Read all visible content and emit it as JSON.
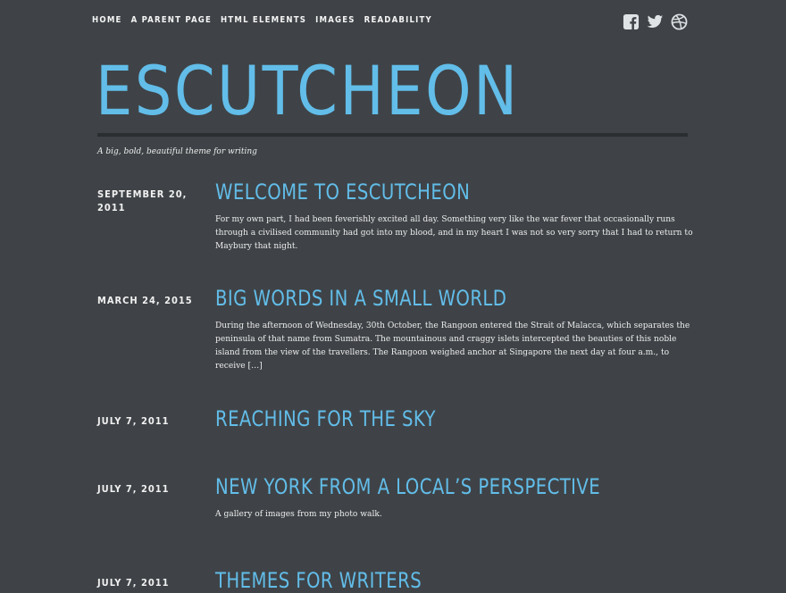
{
  "nav": {
    "items": [
      "HOME",
      "A PARENT PAGE",
      "HTML ELEMENTS",
      "IMAGES",
      "READABILITY"
    ]
  },
  "social": {
    "icons": [
      "facebook-icon",
      "twitter-icon",
      "dribbble-icon"
    ]
  },
  "site": {
    "title": "ESCUTCHEON",
    "tagline": "A big, bold, beautiful theme for writing"
  },
  "posts": [
    {
      "date": "SEPTEMBER 20, 2011",
      "title": "WELCOME TO ESCUTCHEON",
      "excerpt": "For my own part, I had been feverishly excited all day. Something very like the war fever that occasionally runs through a civilised community had got into my blood, and in my heart I was not so very sorry that I had to return to Maybury that night."
    },
    {
      "date": "MARCH 24, 2015",
      "title": "BIG WORDS IN A SMALL WORLD",
      "excerpt": "During the afternoon of Wednesday, 30th October, the Rangoon entered the Strait of Malacca, which separates the peninsula of that name from Sumatra. The mountainous and craggy islets intercepted the beauties of this noble island from the view of the travellers. The Rangoon weighed anchor at Singapore the next day at four a.m., to receive […]"
    },
    {
      "date": "JULY 7, 2011",
      "title": "REACHING FOR THE SKY",
      "excerpt": ""
    },
    {
      "date": "JULY 7, 2011",
      "title": "NEW YORK FROM A LOCAL’S PERSPECTIVE",
      "excerpt": "A gallery of images from my photo walk."
    },
    {
      "date": "JULY 7, 2011",
      "title": "THEMES FOR WRITERS",
      "excerpt": ""
    }
  ],
  "colors": {
    "background": "#3f4347",
    "accent": "#62bde9",
    "rule": "#2b2e31",
    "text": "#f1f1f1",
    "icon": "#dfe3e6"
  }
}
